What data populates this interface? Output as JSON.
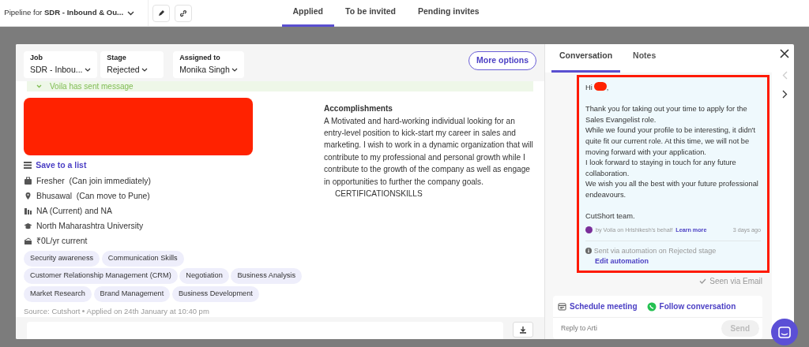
{
  "header": {
    "pipeline_label": "Pipeline for",
    "pipeline_name": "SDR - Inbound & Ou...",
    "tabs": [
      {
        "label": "Applied",
        "selected": true
      },
      {
        "label": "To be invited",
        "selected": false
      },
      {
        "label": "Pending invites",
        "selected": false
      }
    ]
  },
  "candidate": {
    "fields": [
      {
        "label": "Job",
        "value": "SDR - Inbou..."
      },
      {
        "label": "Stage",
        "value": "Rejected"
      },
      {
        "label": "Assigned to",
        "value": "Monika Singh"
      }
    ],
    "more_options": "More options",
    "notice": "Voila has sent message",
    "save_to_list": "Save to a list",
    "facts": [
      {
        "kind": "experience",
        "text": "Fresher  (Can join immediately)"
      },
      {
        "kind": "location",
        "text": "Bhusawal  (Can move to Pune)"
      },
      {
        "kind": "company",
        "text": "NA (Current) and NA"
      },
      {
        "kind": "education",
        "text": "North Maharashtra University"
      },
      {
        "kind": "salary",
        "text": "₹0L/yr current"
      }
    ],
    "skills": [
      "Security awareness",
      "Communication Skills",
      "Customer Relationship Management (CRM)",
      "Negotiation",
      "Business Analysis",
      "Market Research",
      "Brand Management",
      "Business Development"
    ],
    "source": "Source: Cutshort",
    "applied": "Applied on 24th January at 10:40 pm",
    "accomplishments_title": "Accomplishments",
    "accomplishments": "A Motivated and hard-working individual looking for an entry-level position to kick-start my career in sales and marketing. I wish to work in a dynamic organization that will contribute to my professional and personal growth while I contribute to the growth of the company as well as engage in opportunities to further the company goals.",
    "certifications": "CERTIFICATIONSKILLS"
  },
  "conversation": {
    "tabs": [
      {
        "label": "Conversation",
        "selected": true
      },
      {
        "label": "Notes",
        "selected": false
      }
    ],
    "message": {
      "greeting_start": "Hi",
      "greeting_end": ",",
      "body": [
        "Thank you for taking out your time to apply for the Sales Evangelist role.",
        "While we found your profile to be interesting, it didn't quite fit our current role. At this time, we will not be moving forward with your application.",
        "I look forward to staying in touch for any future collaboration.",
        "We wish you all the best with your future professional endeavours."
      ],
      "signature": "CutShort team.",
      "sender": "by Voila on Hrishikesh's behalf",
      "learn_more": "Learn more",
      "time": "3 days ago",
      "automation_note": "Sent via automation on Rejected stage",
      "edit_automation": "Edit automation"
    },
    "seen": "Seen via Email",
    "schedule": "Schedule meeting",
    "follow": "Follow conversation",
    "reply_placeholder": "Reply to Arti",
    "send": "Send"
  }
}
